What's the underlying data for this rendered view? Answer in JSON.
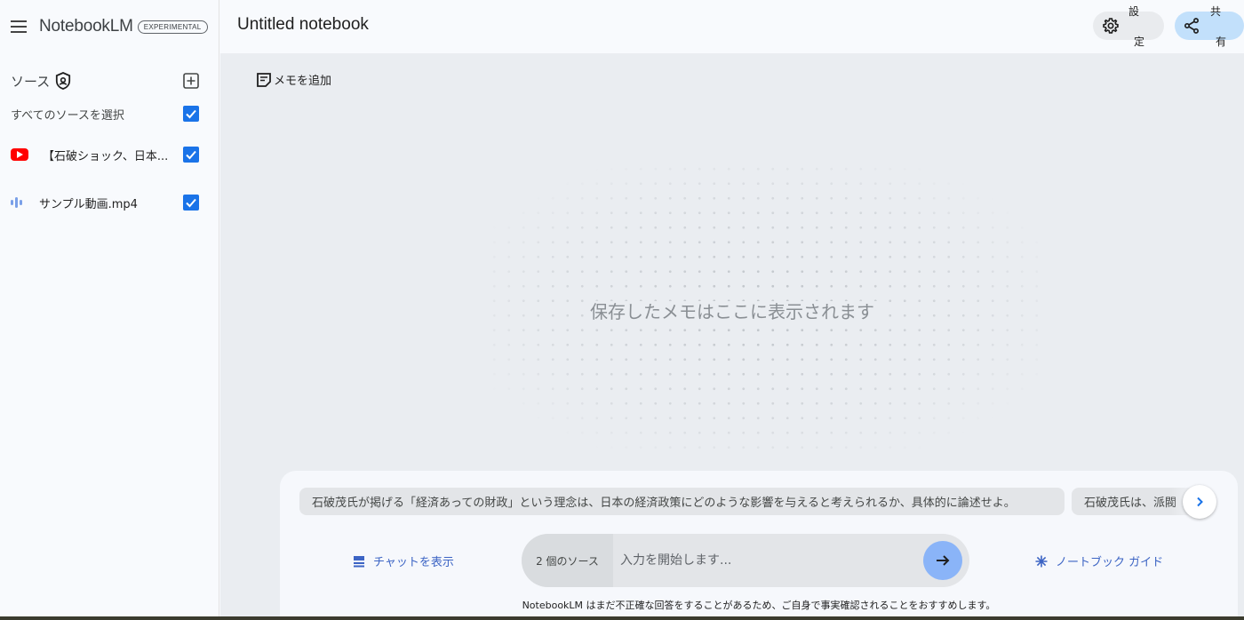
{
  "app": {
    "brand": "NotebookLM",
    "badge": "EXPERIMENTAL"
  },
  "sidebar": {
    "title": "ソース",
    "select_all_label": "すべてのソースを選択",
    "select_all_checked": true,
    "sources": [
      {
        "title": "【石破ショック、日本...",
        "icon": "youtube-icon",
        "checked": true
      },
      {
        "title": "サンプル動画.mp4",
        "icon": "audio-icon",
        "checked": true
      }
    ]
  },
  "header": {
    "notebook_title": "Untitled notebook",
    "settings_label": [
      "設",
      "定"
    ],
    "share_label": [
      "共",
      "有"
    ]
  },
  "notes": {
    "add_note_label": "メモを追加",
    "empty_message": "保存したメモはここに表示されます"
  },
  "chat": {
    "suggestions": [
      "石破茂氏が掲げる「経済あっての財政」という理念は、日本の経済政策にどのような影響を与えると考えられるか、具体的に論述せよ。",
      "石破茂氏は、派閥"
    ],
    "show_chat_label": "チャットを表示",
    "source_count_label": "2 個のソース",
    "input_placeholder": "入力を開始します...",
    "notebook_guide_label": "ノートブック ガイド",
    "disclaimer": "NotebookLM はまだ不正確な回答をすることがあるため、ご自身で事実確認されることをおすすめします。"
  },
  "colors": {
    "accent": "#1a73e8",
    "link": "#3c64c4",
    "send_button": "#8ab4f8",
    "share_button": "#c2e0fb"
  }
}
